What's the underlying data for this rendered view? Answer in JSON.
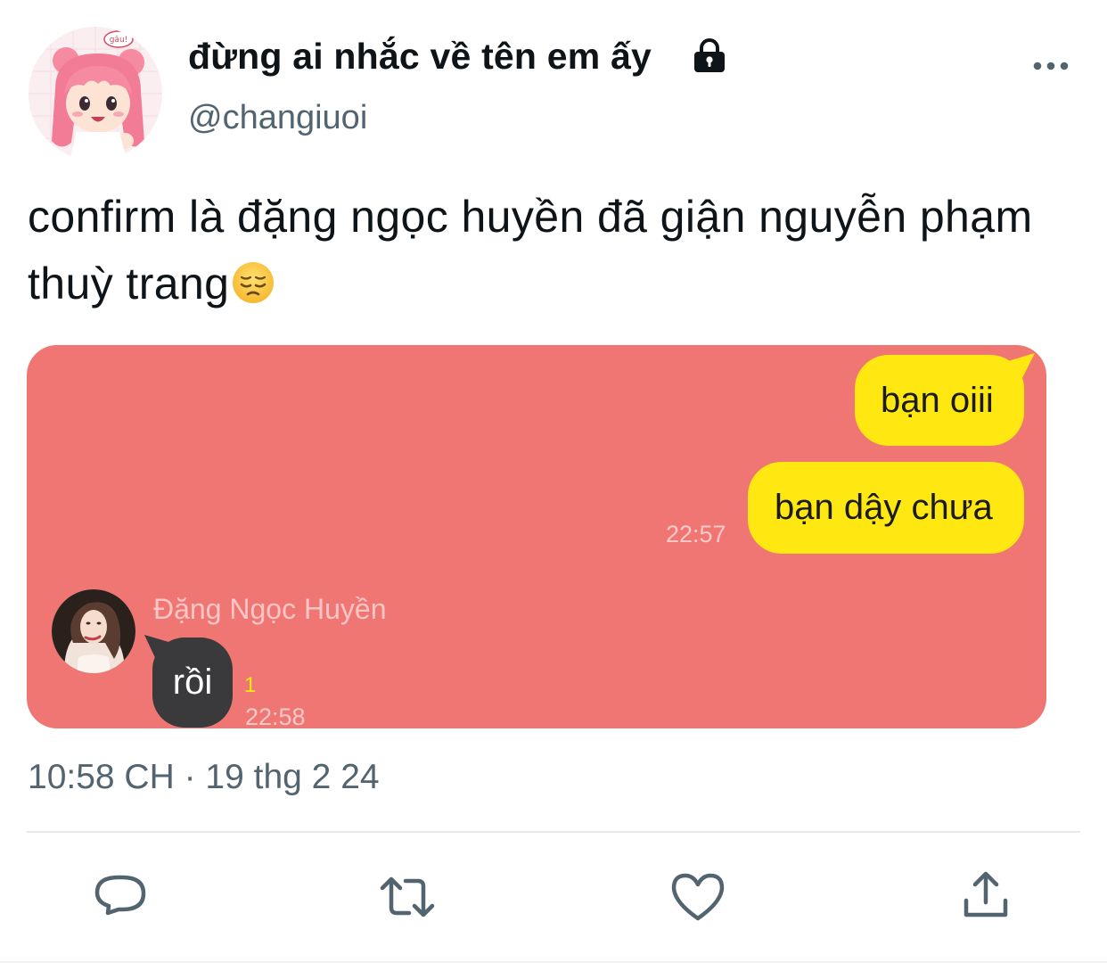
{
  "header": {
    "display_name": "đừng ai nhắc về tên em ấy",
    "handle": "@changiuoi",
    "avatar_sticker_text": "gâu!"
  },
  "tweet": {
    "text": "confirm là đặng ngọc huyền đã giận nguyễn phạm thuỳ trang",
    "emoji": "pensive-face"
  },
  "chat": {
    "sent_messages": [
      "bạn oiii",
      "bạn dậy chưa"
    ],
    "sent_time": "22:57",
    "friend_name": "Đặng Ngọc Huyền",
    "reply_message": "rồi",
    "reply_unread": "1",
    "reply_time": "22:58",
    "colors": {
      "background": "#f07673",
      "sent_bubble": "#ffe812",
      "received_bubble": "#3a3a3c"
    }
  },
  "meta": {
    "timestamp": "10:58 CH · 19 thg 2 24"
  },
  "icons": {
    "lock": "lock-icon",
    "more": "more-icon",
    "reply": "reply-icon",
    "retweet": "retweet-icon",
    "like": "heart-icon",
    "share": "share-icon"
  },
  "colors": {
    "secondary_text": "#536471",
    "primary_text": "#0f1419"
  }
}
